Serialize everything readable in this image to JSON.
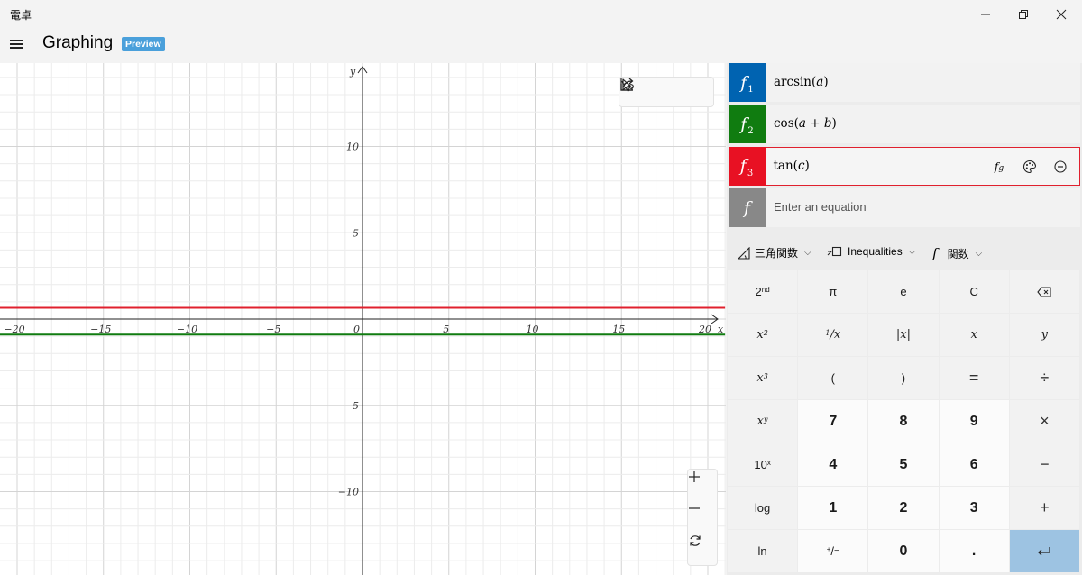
{
  "window": {
    "app_title": "電卓",
    "mode_title": "Graphing",
    "preview_badge": "Preview"
  },
  "graph": {
    "x_range": [
      -21,
      21
    ],
    "y_range": [
      -14.5,
      14.5
    ],
    "x_ticks": [
      "-20",
      "-15",
      "-10",
      "-5",
      "0",
      "5",
      "10",
      "15",
      "20"
    ],
    "y_ticks": [
      "10",
      "5",
      "-5",
      "-10"
    ],
    "x_axis_label": "x",
    "y_axis_label": "y",
    "grid": true
  },
  "chart_data": {
    "type": "line",
    "x_range": [
      -21,
      21
    ],
    "y_range": [
      -14.5,
      14.5
    ],
    "xlabel": "x",
    "ylabel": "y",
    "series": [
      {
        "function": "cos(a + b)",
        "color": "#107c10",
        "x": [
          -21,
          21
        ],
        "y": [
          -0.9,
          -0.9
        ]
      },
      {
        "function": "tan(c)",
        "color": "#e0202e",
        "x": [
          -21,
          21
        ],
        "y": [
          0.65,
          0.65
        ]
      }
    ],
    "grid": true
  },
  "functions": [
    {
      "index": "1",
      "label": "f",
      "parts": [
        "arcsin(",
        "a",
        ")"
      ],
      "color": "#0063b1"
    },
    {
      "index": "2",
      "label": "f",
      "parts": [
        "cos(",
        "a",
        " + ",
        "b",
        ")"
      ],
      "color": "#107c10"
    },
    {
      "index": "3",
      "label": "f",
      "parts": [
        "tan(",
        "c",
        ")"
      ],
      "color": "#e81123"
    }
  ],
  "new_function": {
    "label": "f",
    "placeholder": "Enter an equation",
    "color": "#888888"
  },
  "keypad_tabs": {
    "trig": "三角関数",
    "inequalities": "Inequalities",
    "functions": "関数"
  },
  "icons": {
    "trig": "triangle-icon",
    "inequalities": "inequality-icon",
    "functions": "function-icon",
    "trace": "trace-cursor-icon",
    "share": "share-icon",
    "graph_options": "graph-settings-icon",
    "style": "palette-icon",
    "remove": "minus-circle-icon",
    "analyze": "function-analysis-icon"
  },
  "keys": [
    [
      "2nd",
      "π",
      "e",
      "C",
      "⌫"
    ],
    [
      "x²",
      "¹⁄x",
      "|x|",
      "x",
      "y"
    ],
    [
      "x³",
      "(",
      ")",
      "=",
      "÷"
    ],
    [
      "xʸ",
      "7",
      "8",
      "9",
      "×"
    ],
    [
      "10ˣ",
      "4",
      "5",
      "6",
      "−"
    ],
    [
      "log",
      "1",
      "2",
      "3",
      "+"
    ],
    [
      "ln",
      "⁺⁄₋",
      "0",
      ".",
      "↵"
    ]
  ]
}
